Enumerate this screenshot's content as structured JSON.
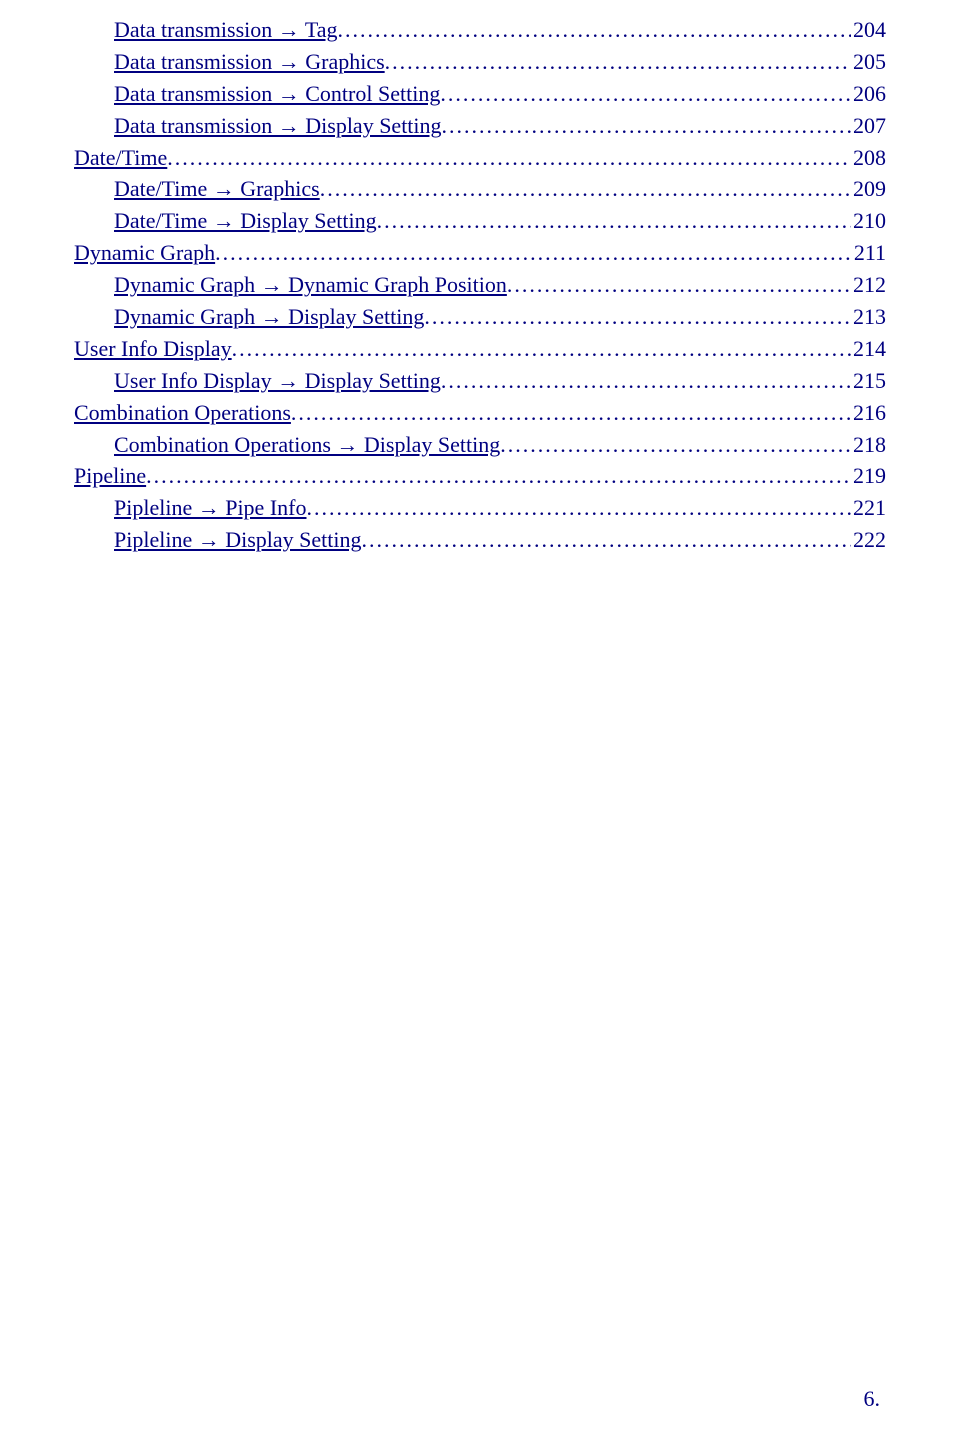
{
  "toc": [
    {
      "level": "sub",
      "label": " Data transmission → Tag ",
      "page": "204"
    },
    {
      "level": "sub",
      "label": " Data transmission → Graphics ",
      "page": "205"
    },
    {
      "level": "sub",
      "label": " Data transmission → Control Setting ",
      "page": "206"
    },
    {
      "level": "sub",
      "label": " Data transmission → Display Setting ",
      "page": "207"
    },
    {
      "level": "top",
      "label": " Date/Time",
      "page": "208"
    },
    {
      "level": "sub",
      "label": " Date/Time → Graphics ",
      "page": "209"
    },
    {
      "level": "sub",
      "label": " Date/Time → Display Setting ",
      "page": "210"
    },
    {
      "level": "top",
      "label": " Dynamic Graph",
      "page": "211"
    },
    {
      "level": "sub",
      "label": " Dynamic Graph → Dynamic Graph Position ",
      "page": "212"
    },
    {
      "level": "sub",
      "label": " Dynamic Graph → Display Setting ",
      "page": "213"
    },
    {
      "level": "top",
      "label": " User Info Display",
      "page": "214"
    },
    {
      "level": "sub",
      "label": " User Info Display → Display Setting ",
      "page": "215"
    },
    {
      "level": "top",
      "label": " Combination Operations",
      "page": "216"
    },
    {
      "level": "sub",
      "label": " Combination Operations → Display Setting ",
      "page": "218"
    },
    {
      "level": "top",
      "label": " Pipeline",
      "page": "219"
    },
    {
      "level": "sub",
      "label": " Pipleline → Pipe Info ",
      "page": "221"
    },
    {
      "level": "sub",
      "label": " Pipleline → Display Setting ",
      "page": "222"
    }
  ],
  "page_number": "6."
}
